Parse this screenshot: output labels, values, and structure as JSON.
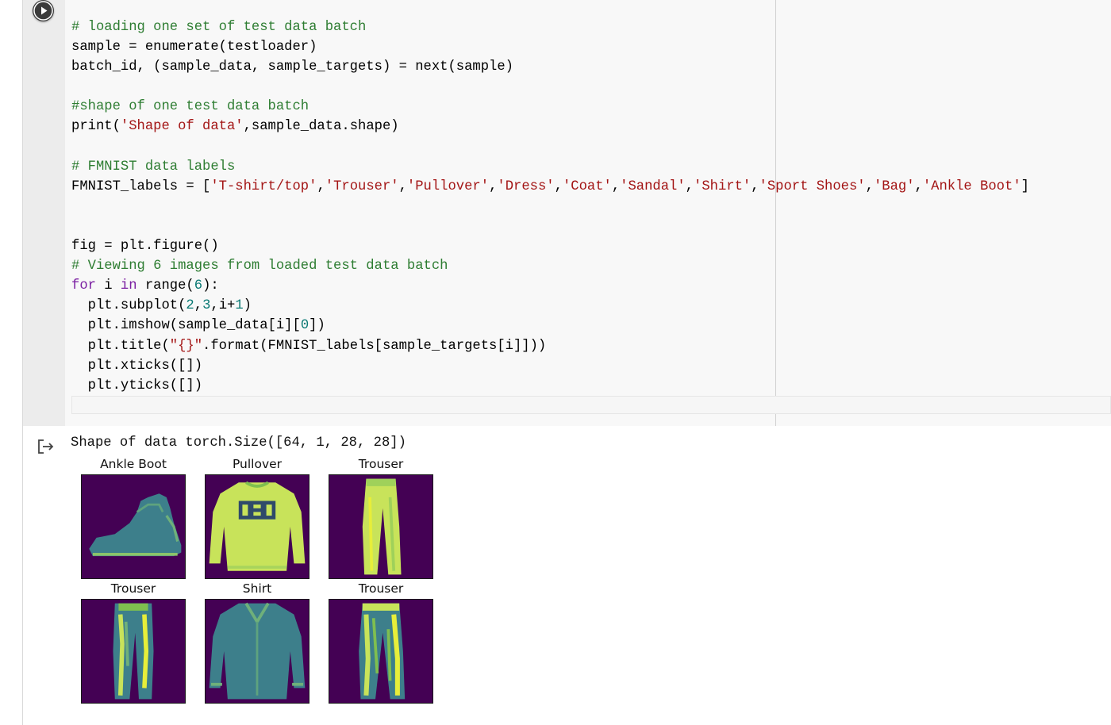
{
  "code_cell": {
    "lines": [
      [
        {
          "t": "# loading one set of test data batch",
          "c": "c"
        }
      ],
      [
        {
          "t": "sample = enumerate(testloader)",
          "c": ""
        }
      ],
      [
        {
          "t": "batch_id, (sample_data, sample_targets) = next(sample)",
          "c": ""
        }
      ],
      [
        {
          "t": "",
          "c": ""
        }
      ],
      [
        {
          "t": "#shape of one test data batch",
          "c": "c"
        }
      ],
      [
        {
          "t": "print(",
          "c": ""
        },
        {
          "t": "'Shape of data'",
          "c": "s"
        },
        {
          "t": ",sample_data.shape)",
          "c": ""
        }
      ],
      [
        {
          "t": "",
          "c": ""
        }
      ],
      [
        {
          "t": "# FMNIST data labels",
          "c": "c"
        }
      ],
      [
        {
          "t": "FMNIST_labels = [",
          "c": ""
        },
        {
          "t": "'T-shirt/top'",
          "c": "s"
        },
        {
          "t": ",",
          "c": ""
        },
        {
          "t": "'Trouser'",
          "c": "s"
        },
        {
          "t": ",",
          "c": ""
        },
        {
          "t": "'Pullover'",
          "c": "s"
        },
        {
          "t": ",",
          "c": ""
        },
        {
          "t": "'Dress'",
          "c": "s"
        },
        {
          "t": ",",
          "c": ""
        },
        {
          "t": "'Coat'",
          "c": "s"
        },
        {
          "t": ",",
          "c": ""
        },
        {
          "t": "'Sandal'",
          "c": "s"
        },
        {
          "t": ",",
          "c": ""
        },
        {
          "t": "'Shirt'",
          "c": "s"
        },
        {
          "t": ",",
          "c": ""
        },
        {
          "t": "'Sport Shoes'",
          "c": "s"
        },
        {
          "t": ",",
          "c": ""
        },
        {
          "t": "'Bag'",
          "c": "s"
        },
        {
          "t": ",",
          "c": ""
        },
        {
          "t": "'Ankle Boot'",
          "c": "s"
        },
        {
          "t": "]",
          "c": ""
        }
      ],
      [
        {
          "t": "",
          "c": ""
        }
      ],
      [
        {
          "t": "",
          "c": ""
        }
      ],
      [
        {
          "t": "fig = plt.figure()",
          "c": ""
        }
      ],
      [
        {
          "t": "# Viewing 6 images from loaded test data batch",
          "c": "c"
        }
      ],
      [
        {
          "t": "for",
          "c": "k"
        },
        {
          "t": " i ",
          "c": ""
        },
        {
          "t": "in",
          "c": "k"
        },
        {
          "t": " range(",
          "c": ""
        },
        {
          "t": "6",
          "c": "n"
        },
        {
          "t": "):",
          "c": ""
        }
      ],
      [
        {
          "t": "  plt.subplot(",
          "c": ""
        },
        {
          "t": "2",
          "c": "n"
        },
        {
          "t": ",",
          "c": ""
        },
        {
          "t": "3",
          "c": "n"
        },
        {
          "t": ",i+",
          "c": ""
        },
        {
          "t": "1",
          "c": "n"
        },
        {
          "t": ")",
          "c": ""
        }
      ],
      [
        {
          "t": "  plt.imshow(sample_data[i][",
          "c": ""
        },
        {
          "t": "0",
          "c": "n"
        },
        {
          "t": "])",
          "c": ""
        }
      ],
      [
        {
          "t": "  plt.title(",
          "c": ""
        },
        {
          "t": "\"{}\"",
          "c": "s"
        },
        {
          "t": ".format(FMNIST_labels[sample_targets[i]]))",
          "c": ""
        }
      ],
      [
        {
          "t": "  plt.xticks([])",
          "c": ""
        }
      ],
      [
        {
          "t": "  plt.yticks([])",
          "c": ""
        }
      ]
    ]
  },
  "output": {
    "shape_text": "Shape of data torch.Size([64, 1, 28, 28])",
    "subplots": [
      {
        "title": "Ankle Boot",
        "image": "ankle-boot"
      },
      {
        "title": "Pullover",
        "image": "pullover"
      },
      {
        "title": "Trouser",
        "image": "trouser"
      },
      {
        "title": "Trouser",
        "image": "trouser"
      },
      {
        "title": "Shirt",
        "image": "shirt"
      },
      {
        "title": "Trouser",
        "image": "trouser"
      }
    ]
  },
  "icons": {
    "run": "play-icon",
    "output": "output-arrow-icon"
  },
  "colors": {
    "background": "#440154",
    "mid": "#3d7f8b",
    "bright": "#c8e35a",
    "yellow": "#e7ee3a"
  }
}
